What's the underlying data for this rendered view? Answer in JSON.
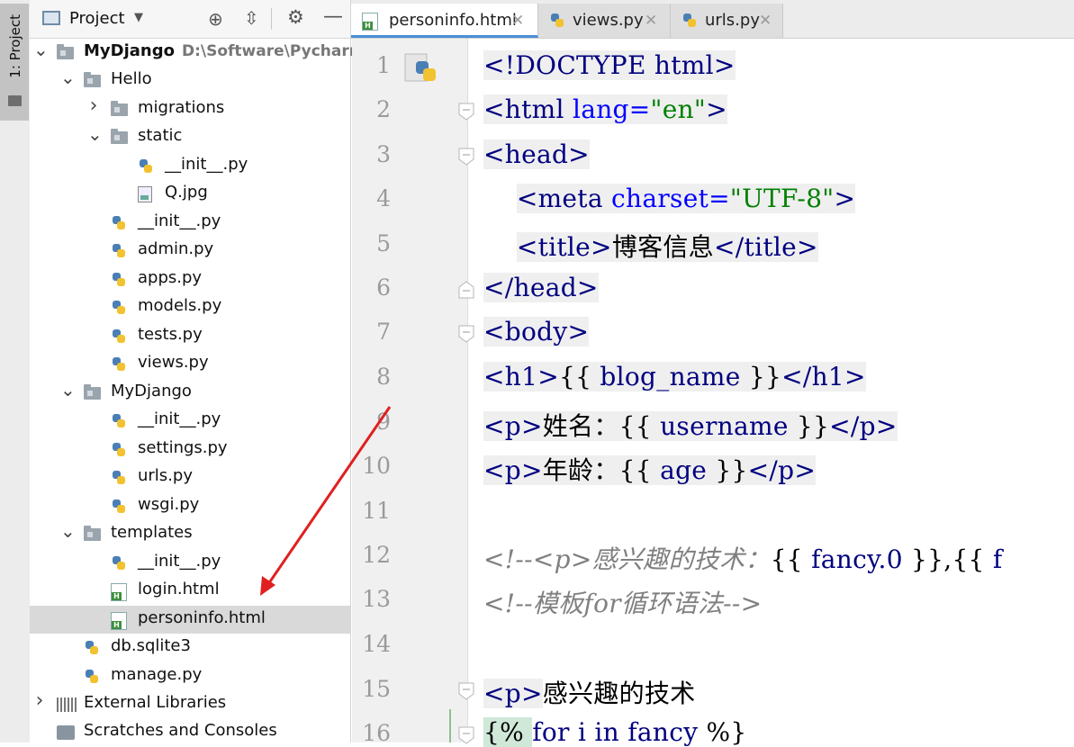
{
  "tool_strip": {
    "project_tab": "1: Project"
  },
  "project_panel": {
    "title": "Project",
    "tree": [
      {
        "label": "MyDjango",
        "path": "D:\\Software\\Pycharm\\W",
        "kind": "folder",
        "expanded": true,
        "bold": true
      },
      {
        "label": "Hello",
        "kind": "folder",
        "expanded": true
      },
      {
        "label": "migrations",
        "kind": "folder",
        "expanded": false
      },
      {
        "label": "static",
        "kind": "folder",
        "expanded": true
      },
      {
        "label": "__init__.py",
        "kind": "py"
      },
      {
        "label": "Q.jpg",
        "kind": "image"
      },
      {
        "label": "__init__.py",
        "kind": "py"
      },
      {
        "label": "admin.py",
        "kind": "py"
      },
      {
        "label": "apps.py",
        "kind": "py"
      },
      {
        "label": "models.py",
        "kind": "py"
      },
      {
        "label": "tests.py",
        "kind": "py"
      },
      {
        "label": "views.py",
        "kind": "py"
      },
      {
        "label": "MyDjango",
        "kind": "folder",
        "expanded": true
      },
      {
        "label": "__init__.py",
        "kind": "py"
      },
      {
        "label": "settings.py",
        "kind": "py"
      },
      {
        "label": "urls.py",
        "kind": "py"
      },
      {
        "label": "wsgi.py",
        "kind": "py"
      },
      {
        "label": "templates",
        "kind": "folder",
        "expanded": true
      },
      {
        "label": "__init__.py",
        "kind": "py"
      },
      {
        "label": "login.html",
        "kind": "html"
      },
      {
        "label": "personinfo.html",
        "kind": "html",
        "selected": true
      },
      {
        "label": "db.sqlite3",
        "kind": "py"
      },
      {
        "label": "manage.py",
        "kind": "py"
      },
      {
        "label": "External Libraries",
        "kind": "lib",
        "expanded": false
      },
      {
        "label": "Scratches and Consoles",
        "kind": "scratch"
      }
    ]
  },
  "tabs": [
    {
      "label": "personinfo.html",
      "kind": "html",
      "active": true
    },
    {
      "label": "views.py",
      "kind": "py",
      "active": false
    },
    {
      "label": "urls.py",
      "kind": "py",
      "active": false
    }
  ],
  "editor": {
    "line_numbers": [
      "1",
      "2",
      "3",
      "4",
      "5",
      "6",
      "7",
      "8",
      "9",
      "10",
      "11",
      "12",
      "13",
      "14",
      "15",
      "16"
    ],
    "lines": {
      "l1_a": "<!DOCTYPE html>",
      "l2_a": "<html ",
      "l2_b": "lang=",
      "l2_c": "\"en\"",
      "l2_d": ">",
      "l3_a": "<head>",
      "l4_a": "<meta ",
      "l4_b": "charset=",
      "l4_c": "\"UTF-8\"",
      "l4_d": ">",
      "l5_a": "<title>",
      "l5_b": "博客信息",
      "l5_c": "</title>",
      "l6_a": "</head>",
      "l7_a": "<body>",
      "l8_a": "<h1>",
      "l8_b": "{{ ",
      "l8_c": "blog_name",
      "l8_d": " }}",
      "l8_e": "</h1>",
      "l9_a": "<p>",
      "l9_b": "姓名：",
      "l9_c": "{{ ",
      "l9_d": "username",
      "l9_e": " }}",
      "l9_f": "</p>",
      "l10_a": "<p>",
      "l10_b": "年龄：",
      "l10_c": "{{ ",
      "l10_d": "age",
      "l10_e": " }}",
      "l10_f": "</p>",
      "l12_a": "<!--<p>感兴趣的技术：",
      "l12_b": "{{ ",
      "l12_c": "fancy.0",
      "l12_d": " }},{{ ",
      "l12_e": "f",
      "l13_a": "<!--模板for循环语法-->",
      "l15_a": "<p>",
      "l15_b": "感兴趣的技术",
      "l16_a": "{% ",
      "l16_b": "for ",
      "l16_c": "i ",
      "l16_d": "in ",
      "l16_e": "fancy",
      "l16_f": " %}"
    }
  },
  "colors": {
    "accent": "#4a8fd6",
    "annotation_arrow": "#e02020",
    "selection": "#d9d9d9"
  }
}
